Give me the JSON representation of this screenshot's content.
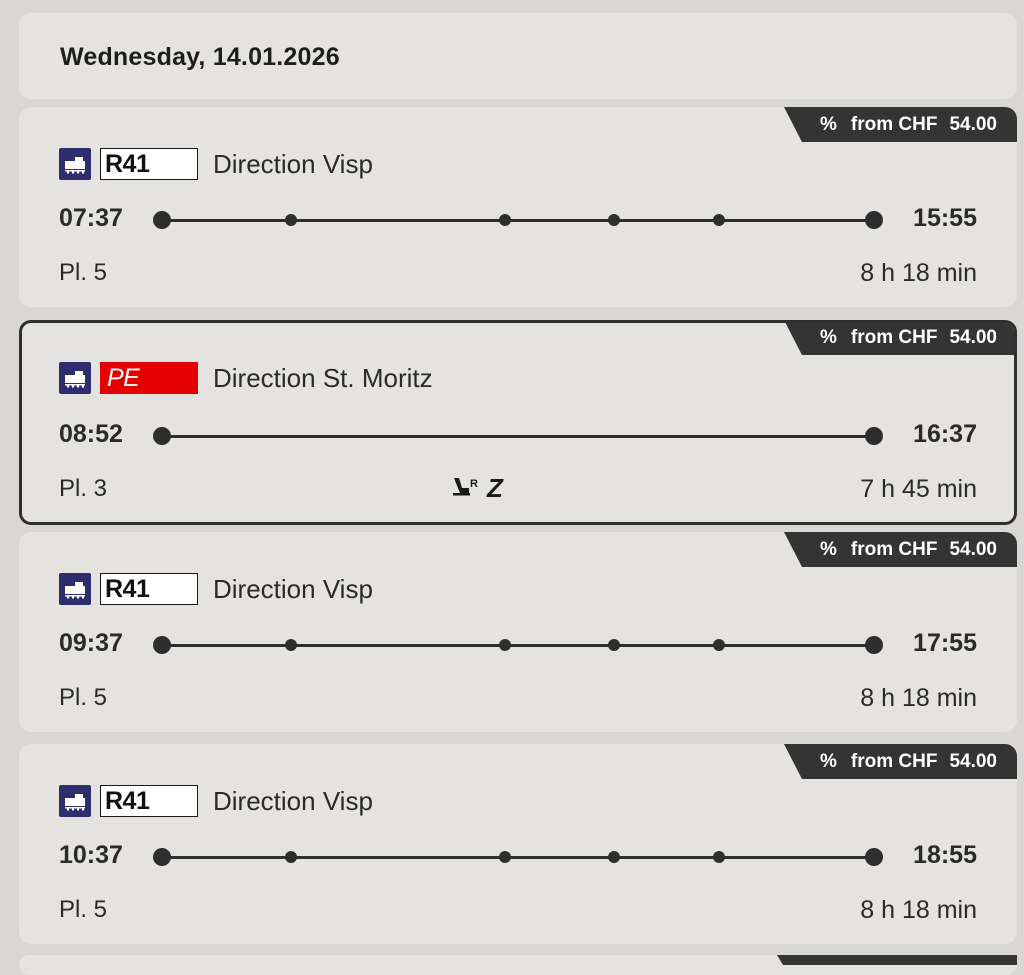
{
  "header": {
    "date": "Wednesday, 14.01.2026"
  },
  "price": {
    "symbol": "%",
    "from": "from CHF",
    "amount": "54.00"
  },
  "connections": [
    {
      "line": "R41",
      "line_style": "regular",
      "direction": "Direction Visp",
      "departure": "07:37",
      "arrival": "15:55",
      "platform": "Pl. 5",
      "duration": "8 h 18 min",
      "selected": false,
      "stops": 4
    },
    {
      "line": "PE",
      "line_style": "panorama",
      "line_color": "#e50000",
      "direction": "Direction St. Moritz",
      "departure": "08:52",
      "arrival": "16:37",
      "platform": "Pl. 3",
      "duration": "7 h 45 min",
      "selected": true,
      "stops": 0,
      "features": {
        "reservation_icon": "seat-reservation-icon",
        "reservation_mark": "R",
        "surcharge": "Z"
      }
    },
    {
      "line": "R41",
      "line_style": "regular",
      "direction": "Direction Visp",
      "departure": "09:37",
      "arrival": "17:55",
      "platform": "Pl. 5",
      "duration": "8 h 18 min",
      "selected": false,
      "stops": 4
    },
    {
      "line": "R41",
      "line_style": "regular",
      "direction": "Direction Visp",
      "departure": "10:37",
      "arrival": "18:55",
      "platform": "Pl. 5",
      "duration": "8 h 18 min",
      "selected": false,
      "stops": 4
    }
  ]
}
